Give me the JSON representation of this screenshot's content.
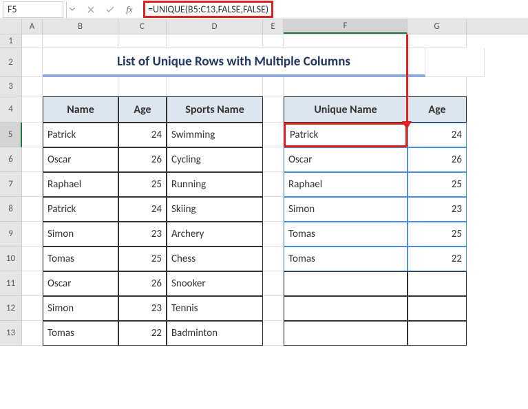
{
  "name_box": "F5",
  "formula": "=UNIQUE(B5:C13,FALSE,FALSE)",
  "columns": [
    "A",
    "B",
    "C",
    "D",
    "E",
    "F",
    "G"
  ],
  "rows": [
    "1",
    "2",
    "3",
    "4",
    "5",
    "6",
    "7",
    "8",
    "9",
    "10",
    "11",
    "12",
    "13"
  ],
  "title": "List of Unique Rows with Multiple Columns",
  "left_headers": {
    "name": "Name",
    "age": "Age",
    "sport": "Sports Name"
  },
  "right_headers": {
    "uname": "Unique Name",
    "age": "Age"
  },
  "left_data": [
    {
      "name": "Patrick",
      "age": "24",
      "sport": "Swimming"
    },
    {
      "name": "Oscar",
      "age": "26",
      "sport": "Cycling"
    },
    {
      "name": "Raphael",
      "age": "25",
      "sport": "Running"
    },
    {
      "name": "Patrick",
      "age": "24",
      "sport": "Skiing"
    },
    {
      "name": "Simon",
      "age": "23",
      "sport": "Archery"
    },
    {
      "name": "Tomas",
      "age": "25",
      "sport": "Chess"
    },
    {
      "name": "Oscar",
      "age": "26",
      "sport": "Snooker"
    },
    {
      "name": "Simon",
      "age": "23",
      "sport": "Tennis"
    },
    {
      "name": "Tomas",
      "age": "22",
      "sport": "Badminton"
    }
  ],
  "right_data": [
    {
      "name": "Patrick",
      "age": "24"
    },
    {
      "name": "Oscar",
      "age": "26"
    },
    {
      "name": "Raphael",
      "age": "25"
    },
    {
      "name": "Simon",
      "age": "23"
    },
    {
      "name": "Tomas",
      "age": "25"
    },
    {
      "name": "Tomas",
      "age": "22"
    }
  ],
  "fx": "fx"
}
